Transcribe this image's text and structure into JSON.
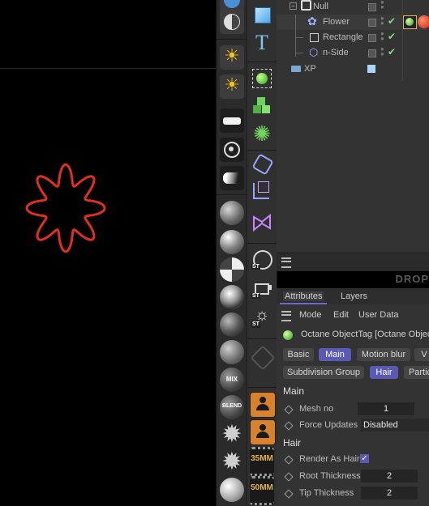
{
  "colors": {
    "viewport_bg": "#000000",
    "flower_stroke": "#e0301e",
    "accent_purple": "#5a5ab4",
    "check_green": "#7ddc7d",
    "panel_bg": "#333333"
  },
  "palette_left": {
    "icons": [
      "octane-half-moon-icon",
      "octane-half-circle-icon",
      "sun-light-icon",
      "sun-light-alt-icon",
      "area-light-icon",
      "spot-target-icon",
      "spotlight-icon",
      "sphere-material-icon",
      "sphere-glossy-icon",
      "sphere-checker-icon",
      "sphere-chrome-icon",
      "sphere-dark-icon",
      "sphere-plain-icon",
      "mix-material-icon",
      "blend-material-icon",
      "gear-shape-icon",
      "gear-shape-alt-icon",
      "sphere-white-icon"
    ],
    "mix_label": "MIX",
    "blend_label": "BLEND"
  },
  "palette_right": {
    "icons": [
      "cube-icon",
      "text-icon",
      "octane-object-tag-icon",
      "cloner-cubes-icon",
      "gear-tag-icon",
      "deformer-icon",
      "spline-box-icon",
      "spline-pen-icon",
      "st-sphere-icon",
      "st-camera-icon",
      "st-light-icon",
      "disabled-tag-icon",
      "camera-person-icon",
      "camera-person-alt-icon",
      "film-35mm-icon",
      "film-50mm-icon"
    ],
    "film_35": "35MM",
    "film_50": "50MM"
  },
  "object_manager": {
    "rows": [
      {
        "name": "Null",
        "icon": "null-object-icon"
      },
      {
        "name": "Flower",
        "icon": "flower-spline-icon"
      },
      {
        "name": "Rectangle",
        "icon": "rectangle-spline-icon"
      },
      {
        "name": "n-Side",
        "icon": "nside-spline-icon"
      },
      {
        "name": "XP",
        "icon": "folder-icon"
      }
    ],
    "drop_label": "DROP"
  },
  "attributes": {
    "tabs": [
      "Attributes",
      "Layers"
    ],
    "menu": [
      "Mode",
      "Edit",
      "User Data"
    ],
    "header": "Octane ObjectTag [Octane ObjectT",
    "pills_row1": [
      "Basic",
      "Main",
      "Motion blur",
      "V"
    ],
    "pills_row2": [
      "Subdivision Group",
      "Hair",
      "Partic"
    ],
    "main_section": "Main",
    "hair_section": "Hair",
    "mesh_no_label": "Mesh no",
    "mesh_no_value": "1",
    "force_updates_label": "Force Updates",
    "force_updates_value": "Disabled",
    "render_as_hair_label": "Render As Hair",
    "render_as_hair_checked": true,
    "root_thickness_label": "Root Thickness",
    "root_thickness_value": "2",
    "tip_thickness_label": "Tip Thickness",
    "tip_thickness_value": "2"
  }
}
